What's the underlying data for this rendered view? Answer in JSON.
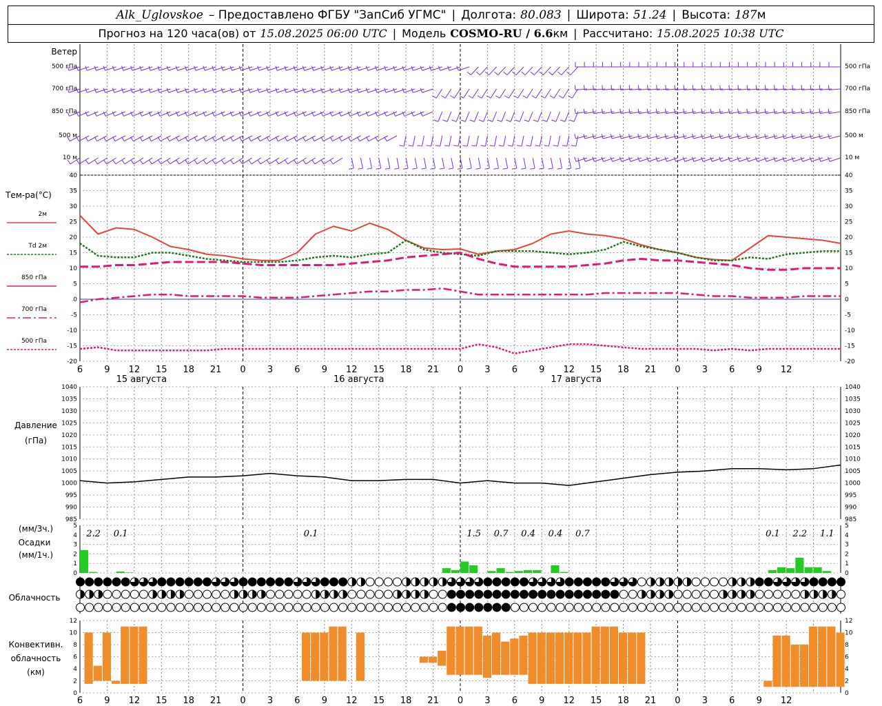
{
  "header": {
    "station": "Alk_Uglovskoe",
    "provider": "– Предоставлено ФГБУ \"ЗапСиб УГМС\"",
    "lon_label": "Долгота:",
    "lon_value": "80.083",
    "lat_label": "Широта:",
    "lat_value": "51.24",
    "alt_label": "Высота:",
    "alt_value": "187",
    "alt_unit": "м",
    "forecast_label": "Прогноз на 120 часа(ов) от",
    "forecast_start": "15.08.2025 06:00 UTC",
    "model_label": "Модель",
    "model_name": "COSMO-RU / 6.6",
    "model_unit": "км",
    "calc_label": "Рассчитано:",
    "calc_time": "15.08.2025 10:38 UTC"
  },
  "time_axis": {
    "hour_labels": [
      "6",
      "9",
      "12",
      "15",
      "18",
      "21",
      "0",
      "3",
      "6",
      "9",
      "12",
      "15",
      "18",
      "21",
      "0",
      "3",
      "6",
      "9",
      "12",
      "15",
      "18",
      "21",
      "0",
      "3",
      "6",
      "9",
      "12"
    ],
    "day_labels": [
      "15 августа",
      "16 августа",
      "17 августа"
    ]
  },
  "panels": {
    "wind": {
      "title": "Ветер",
      "levels": [
        "500 гПа",
        "700 гПа",
        "850 гПа",
        "500 м",
        "10 м"
      ],
      "color": "#7b2bd6"
    },
    "temperature": {
      "title": "Тем-ра(°C)",
      "legend": [
        {
          "label": "2м",
          "color": "#e8433a",
          "style": "solid"
        },
        {
          "label": "Td 2м",
          "color": "#1a7a1a",
          "style": "dotted"
        },
        {
          "label": "850 гПа",
          "color": "#e0187a",
          "style": "solid"
        },
        {
          "label": "700 гПа",
          "color": "#e0187a",
          "style": "dashdot"
        },
        {
          "label": "500 гПа",
          "color": "#e0187a",
          "style": "dotted"
        }
      ],
      "y_ticks": [
        "40",
        "35",
        "30",
        "25",
        "20",
        "15",
        "10",
        "5",
        "0",
        "-5",
        "-10",
        "-15",
        "-20"
      ]
    },
    "pressure": {
      "title": "Давление",
      "unit": "(гПа)",
      "y_ticks": [
        "1040",
        "1035",
        "1030",
        "1025",
        "1020",
        "1015",
        "1010",
        "1005",
        "1000",
        "995",
        "990",
        "985"
      ]
    },
    "precip": {
      "title_units_3h": "(мм/3ч.)",
      "title": "Осадки",
      "title_units_1h": "(мм/1ч.)",
      "y_ticks": [
        "5",
        "4",
        "3",
        "2",
        "1",
        "0"
      ],
      "totals_3h": [
        {
          "hour": 1.5,
          "text": "2.2"
        },
        {
          "hour": 4.5,
          "text": "0.1"
        },
        {
          "hour": 25.5,
          "text": "0.1"
        },
        {
          "hour": 43.5,
          "text": "1.5"
        },
        {
          "hour": 46.5,
          "text": "0.7"
        },
        {
          "hour": 49.5,
          "text": "0.4"
        },
        {
          "hour": 52.5,
          "text": "0.4"
        },
        {
          "hour": 55.5,
          "text": "0.7"
        },
        {
          "hour": 76.5,
          "text": "0.1"
        },
        {
          "hour": 79.5,
          "text": "2.2"
        },
        {
          "hour": 82.5,
          "text": "1.1"
        }
      ]
    },
    "clouds": {
      "title": "Облачность"
    },
    "convective": {
      "title_line1": "Конвективн.",
      "title_line2": "облачность",
      "title_line3": "(км)",
      "y_ticks": [
        "12",
        "10",
        "8",
        "6",
        "4",
        "2",
        "0"
      ],
      "color": "#f08c2a"
    }
  },
  "chart_data": [
    {
      "type": "line",
      "title": "Тем-ра(°C)",
      "x_hours_from_start": [
        0,
        2,
        4,
        6,
        8,
        10,
        12,
        14,
        16,
        18,
        20,
        22,
        24,
        26,
        28,
        30,
        32,
        34,
        36,
        38,
        40,
        42,
        44,
        46,
        48,
        50,
        52,
        54,
        56,
        58,
        60,
        62,
        64,
        66,
        68,
        70,
        72,
        74,
        76,
        78,
        80,
        82,
        84
      ],
      "ylim": [
        -20,
        40
      ],
      "series": [
        {
          "name": "2м",
          "values": [
            27,
            21,
            23,
            22.5,
            20,
            17,
            16,
            14.5,
            14,
            13,
            12.5,
            12.5,
            15,
            21,
            23.5,
            22,
            24.5,
            22.5,
            19,
            16.5,
            16,
            16.2,
            14.5,
            15.5,
            16,
            18,
            21,
            22,
            21,
            20.5,
            19.5,
            17.5,
            16,
            15,
            13.5,
            12.8,
            12.5,
            16.5,
            20.5,
            20,
            19.5,
            19,
            18
          ]
        },
        {
          "name": "Td 2м",
          "values": [
            18,
            14,
            13.5,
            13.5,
            15,
            15,
            14,
            13,
            12.5,
            12,
            12,
            12,
            12.5,
            13.5,
            14,
            13.5,
            14.5,
            15,
            19,
            16,
            15,
            14.5,
            14,
            15.5,
            15.5,
            15.5,
            15,
            14.5,
            15,
            16,
            18.5,
            17,
            16,
            15,
            13.5,
            12.5,
            12.5,
            13.5,
            13,
            14.5,
            15,
            15.5,
            15.5
          ]
        },
        {
          "name": "850 гПа",
          "values": [
            10.5,
            10.5,
            11,
            11,
            11.5,
            12,
            12,
            12,
            12,
            11.5,
            11,
            11,
            11,
            11,
            11,
            11.5,
            12,
            12.5,
            13.5,
            14,
            14.5,
            15,
            13,
            11.5,
            10.5,
            10.5,
            10.5,
            10.5,
            11,
            11.5,
            12.5,
            13,
            12.5,
            12.5,
            12,
            11.5,
            11,
            10,
            9.5,
            9.5,
            10,
            10,
            10
          ]
        },
        {
          "name": "700 гПа",
          "values": [
            -1,
            0,
            0.5,
            1,
            1.5,
            1.5,
            1,
            1,
            1,
            1,
            0.5,
            0.5,
            0.5,
            1,
            1.5,
            2,
            2.5,
            2.5,
            3,
            3,
            3.5,
            2.5,
            1.5,
            1.5,
            1.5,
            1.5,
            1.5,
            1.5,
            1.5,
            2,
            2,
            2,
            2,
            2,
            1.5,
            1,
            1,
            0.5,
            0.5,
            0.5,
            1,
            1,
            1
          ]
        },
        {
          "name": "500 гПа",
          "values": [
            -16,
            -15.5,
            -16.5,
            -16.5,
            -16.5,
            -16.5,
            -16.5,
            -16.5,
            -16,
            -16,
            -16,
            -16,
            -16,
            -16,
            -16,
            -16,
            -16,
            -16,
            -16,
            -16,
            -16,
            -16,
            -14.5,
            -15.5,
            -17.5,
            -16.5,
            -15.5,
            -14.5,
            -14.5,
            -15,
            -15.5,
            -16,
            -16,
            -16,
            -16,
            -16.5,
            -16,
            -16.5,
            -16,
            -16,
            -16,
            -16,
            -16
          ]
        }
      ]
    },
    {
      "type": "line",
      "title": "Давление",
      "ylabel": "(гПа)",
      "ylim": [
        985,
        1040
      ],
      "x_hours_from_start": [
        0,
        3,
        6,
        9,
        12,
        15,
        18,
        21,
        24,
        27,
        30,
        33,
        36,
        39,
        42,
        45,
        48,
        51,
        54,
        57,
        60,
        63,
        66,
        69,
        72,
        75,
        78,
        81,
        84
      ],
      "series": [
        {
          "name": "",
          "values": [
            1001,
            1000,
            1000.5,
            1001.5,
            1002.5,
            1002.5,
            1003,
            1004,
            1003,
            1002.5,
            1001,
            1001,
            1001.5,
            1001.5,
            1000,
            1001,
            1000,
            1000,
            999,
            1000.5,
            1002,
            1003.5,
            1004.5,
            1005,
            1006,
            1006,
            1005.5,
            1006,
            1007.5
          ]
        }
      ]
    },
    {
      "type": "bar",
      "title": "Осадки",
      "ylabel": "(мм/1ч.)",
      "ylim": [
        0,
        5
      ],
      "x_hours_from_start": [
        0,
        1,
        2,
        3,
        4,
        5,
        40,
        41,
        42,
        43,
        44,
        45,
        46,
        47,
        48,
        49,
        50,
        51,
        52,
        53,
        54,
        55,
        56,
        57,
        58,
        59,
        60,
        61,
        62,
        63,
        64,
        65,
        66,
        67,
        68,
        69,
        70,
        71,
        72,
        73,
        74,
        75,
        76,
        77,
        78,
        79,
        80,
        81,
        82,
        83,
        84
      ],
      "values": [
        2.4,
        0.1,
        0,
        0,
        0.15,
        0.05,
        0.5,
        0.3,
        1.2,
        0.8,
        0,
        0.2,
        0.5,
        0.1,
        0.2,
        0.3,
        0.3,
        0,
        0.8,
        0.1,
        0,
        0,
        0,
        0,
        0,
        0,
        0,
        0,
        0,
        0,
        0,
        0,
        0,
        0,
        0,
        0,
        0,
        0,
        0,
        0,
        0,
        0,
        0.3,
        0.6,
        0.5,
        1.6,
        0.6,
        0.6,
        0.2,
        0,
        0
      ]
    },
    {
      "type": "bar",
      "title": "Конвективн. облачность",
      "ylabel": "(км)",
      "ylim": [
        0,
        12
      ],
      "x_hours_from_start": [
        1,
        2,
        3,
        4,
        5,
        6,
        7,
        24,
        25,
        26,
        27,
        28,
        29,
        30,
        31,
        38,
        39,
        40,
        41,
        42,
        43,
        44,
        45,
        46,
        47,
        48,
        49,
        50,
        51,
        52,
        53,
        54,
        55,
        56,
        57,
        58,
        59,
        60,
        61,
        62,
        75,
        76,
        77,
        78,
        79,
        80,
        81,
        82,
        83,
        84
      ],
      "bases": [
        1.5,
        2,
        2,
        1.5,
        1.5,
        1.5,
        1.5,
        1.5,
        2,
        2,
        2,
        2,
        2,
        2,
        2,
        5,
        5,
        4.5,
        3,
        3,
        3,
        3,
        2.5,
        3,
        3,
        3,
        3,
        1.5,
        1.5,
        1.5,
        1.5,
        1.5,
        1.5,
        1.5,
        1.5,
        1.5,
        1.5,
        1.5,
        1.5,
        1.5,
        1.5,
        1,
        1,
        1,
        1,
        1,
        1,
        1,
        1,
        1
      ],
      "tops": [
        10,
        4.5,
        10,
        2,
        11,
        11,
        11,
        1.5,
        10,
        10,
        10,
        11,
        11,
        2,
        10,
        6,
        6,
        7,
        11,
        11,
        11,
        11,
        9.5,
        10,
        8.5,
        9,
        9.5,
        10,
        10,
        10,
        10,
        10,
        10,
        10,
        11,
        11,
        11,
        10,
        10,
        10,
        1.5,
        2,
        9.5,
        9.5,
        8,
        8,
        11,
        11,
        11,
        10
      ]
    }
  ]
}
